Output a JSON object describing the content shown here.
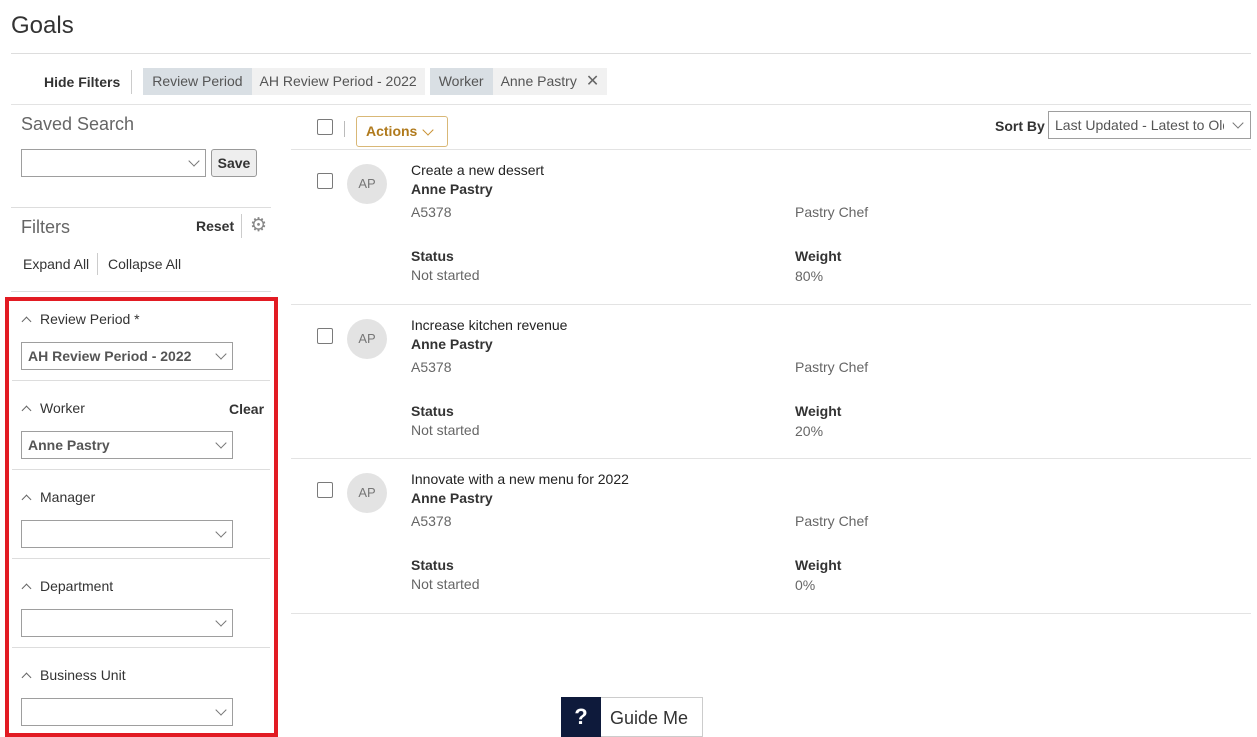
{
  "page": {
    "title": "Goals"
  },
  "filter_bar": {
    "hide_filters_label": "Hide Filters",
    "chips": [
      {
        "key": "Review Period",
        "value": "AH Review Period - 2022",
        "removable": false
      },
      {
        "key": "Worker",
        "value": "Anne Pastry",
        "removable": true
      }
    ],
    "remove_icon": "close-icon"
  },
  "left_panel": {
    "saved_search": {
      "title": "Saved Search",
      "selected": "",
      "save_label": "Save"
    },
    "filters": {
      "title": "Filters",
      "reset_label": "Reset",
      "settings_icon": "gear-icon",
      "expand_all_label": "Expand All",
      "collapse_all_label": "Collapse All"
    },
    "facets": [
      {
        "label": "Review Period *",
        "value": "AH Review Period - 2022",
        "clear_label": ""
      },
      {
        "label": "Worker",
        "value": "Anne Pastry",
        "clear_label": "Clear"
      },
      {
        "label": "Manager",
        "value": "",
        "clear_label": ""
      },
      {
        "label": "Department",
        "value": "",
        "clear_label": ""
      },
      {
        "label": "Business Unit",
        "value": "",
        "clear_label": ""
      }
    ],
    "highlight_color": "#e21b23"
  },
  "toolbar": {
    "actions_label": "Actions",
    "sort_by_label": "Sort By",
    "sort_value": "Last Updated - Latest to Oldest"
  },
  "goals": [
    {
      "initials": "AP",
      "title": "Create a new dessert",
      "worker": "Anne Pastry",
      "id": "A5378",
      "job": "Pastry Chef",
      "status_label": "Status",
      "status": "Not started",
      "weight_label": "Weight",
      "weight": "80%"
    },
    {
      "initials": "AP",
      "title": "Increase kitchen revenue",
      "worker": "Anne Pastry",
      "id": "A5378",
      "job": "Pastry Chef",
      "status_label": "Status",
      "status": "Not started",
      "weight_label": "Weight",
      "weight": "20%"
    },
    {
      "initials": "AP",
      "title": "Innovate with a new menu for 2022",
      "worker": "Anne Pastry",
      "id": "A5378",
      "job": "Pastry Chef",
      "status_label": "Status",
      "status": "Not started",
      "weight_label": "Weight",
      "weight": "0%"
    }
  ],
  "guide_me": {
    "icon": "question-icon",
    "icon_glyph": "?",
    "label": "Guide Me"
  },
  "colors": {
    "accent_gold": "#b07a1c",
    "guide_navy": "#0e1a3b"
  }
}
